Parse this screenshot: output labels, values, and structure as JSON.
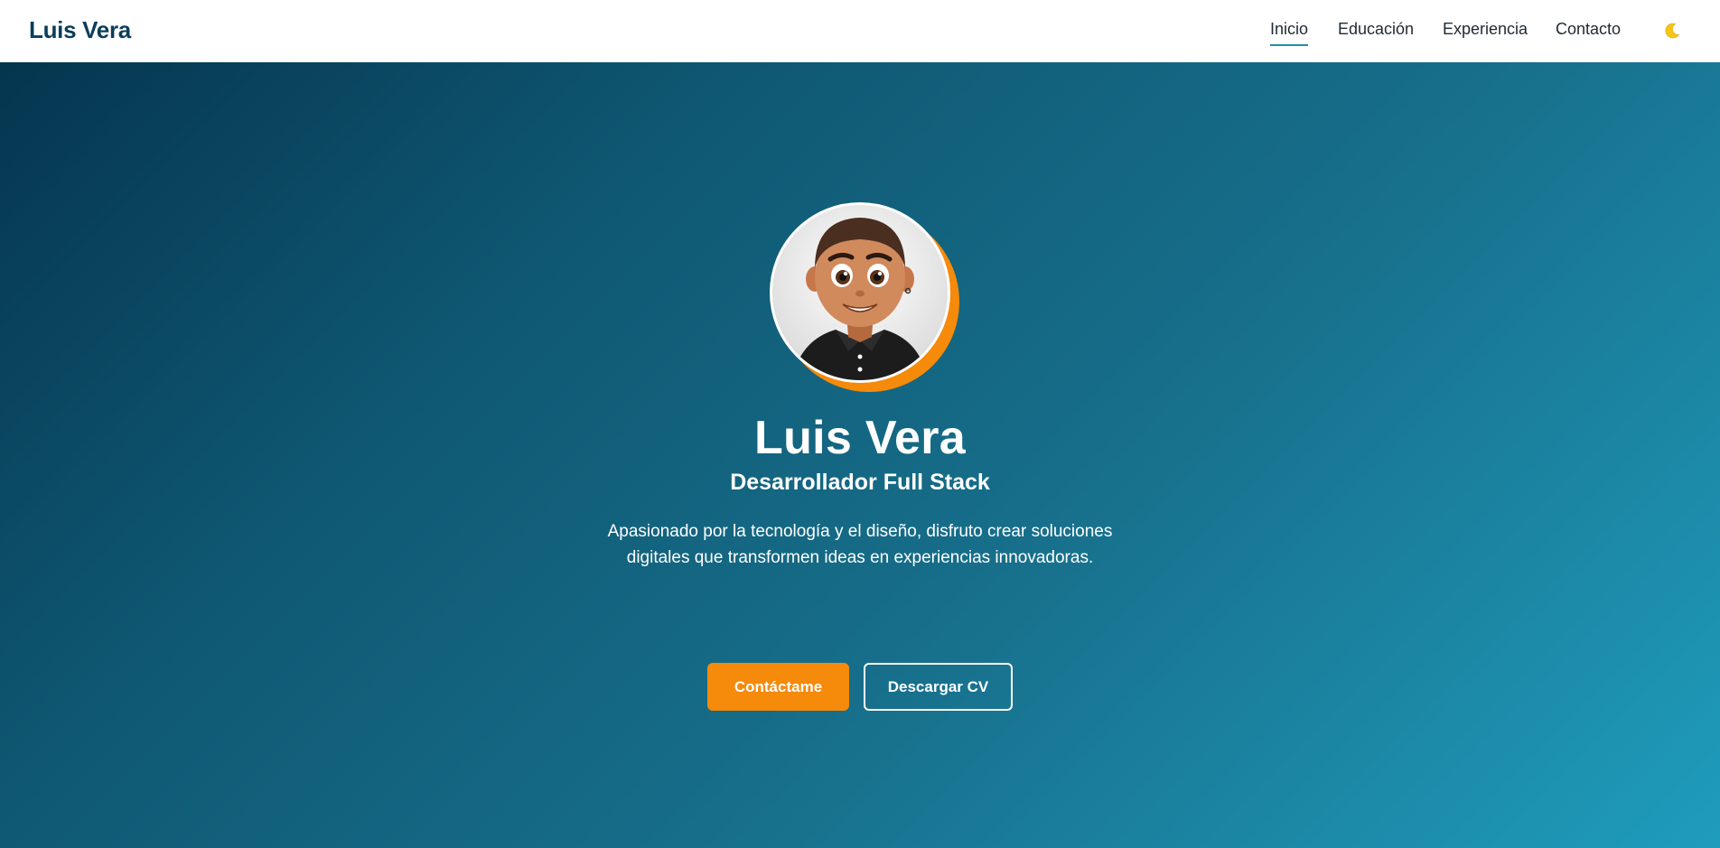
{
  "nav": {
    "brand": "Luis Vera",
    "links": [
      {
        "label": "Inicio",
        "active": true
      },
      {
        "label": "Educación",
        "active": false
      },
      {
        "label": "Experiencia",
        "active": false
      },
      {
        "label": "Contacto",
        "active": false
      }
    ],
    "theme_toggle_icon": "moon-icon"
  },
  "hero": {
    "avatar_icon": "avatar-illustration",
    "name": "Luis Vera",
    "role": "Desarrollador Full Stack",
    "bio": "Apasionado por la tecnología y el diseño, disfruto crear soluciones digitales que transformen ideas en experiencias innovadoras.",
    "primary_button": "Contáctame",
    "secondary_button": "Descargar CV"
  },
  "colors": {
    "brand": "#0b3d5a",
    "accent": "#f58a0b",
    "nav_underline": "#1e8fa6",
    "hero_gradient_start": "#05354f",
    "hero_gradient_end": "#1f9cbc"
  }
}
